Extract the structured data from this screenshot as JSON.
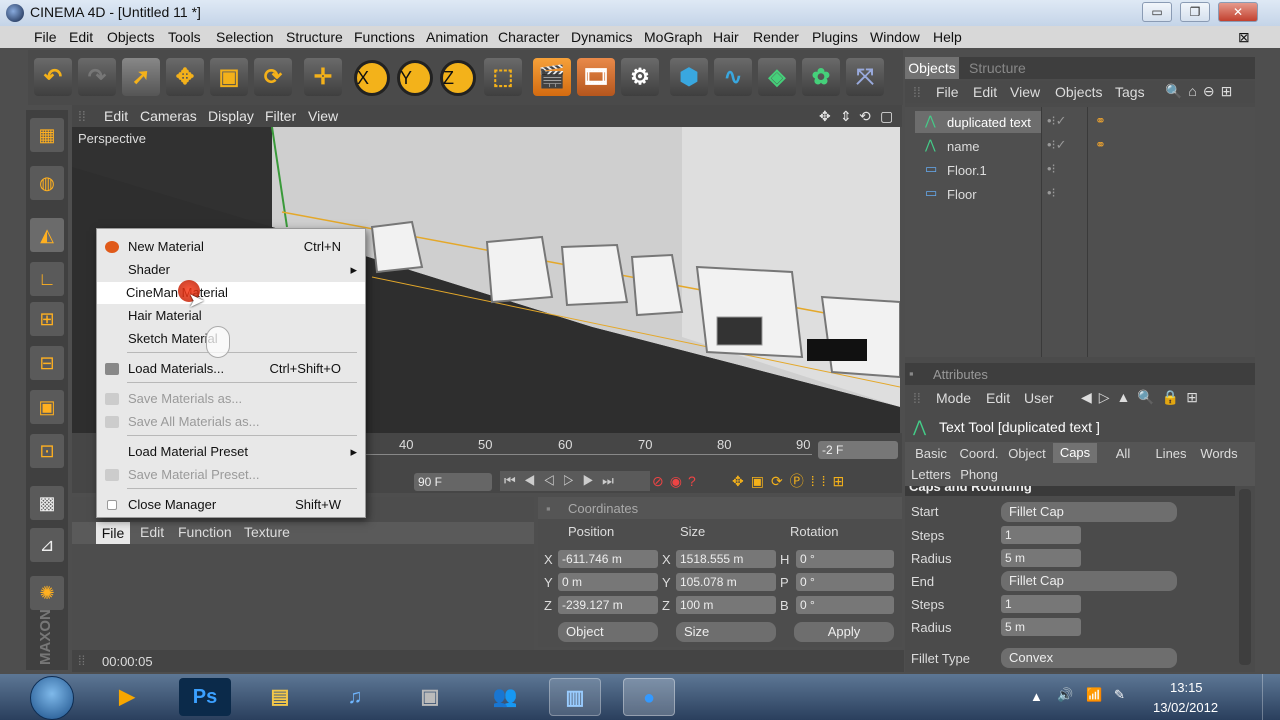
{
  "window": {
    "title": "CINEMA 4D - [Untitled 11 *]",
    "minimize": "▭",
    "restore": "❐",
    "close": "✕"
  },
  "menu": [
    "File",
    "Edit",
    "Objects",
    "Tools",
    "Selection",
    "Structure",
    "Functions",
    "Animation",
    "Character",
    "Dynamics",
    "MoGraph",
    "Hair",
    "Render",
    "Plugins",
    "Window",
    "Help"
  ],
  "toolbar": {
    "axis_x": "X",
    "axis_y": "Y",
    "axis_z": "Z"
  },
  "viewport": {
    "menu": [
      "Edit",
      "Cameras",
      "Display",
      "Filter",
      "View"
    ],
    "label": "Perspective",
    "scene_text": "EXEPIIOZ"
  },
  "timeline": {
    "ticks": [
      "40",
      "50",
      "60",
      "70",
      "80",
      "90"
    ],
    "frame_end": "-2 F",
    "max_frames": "90 F"
  },
  "materials": {
    "tabs": [
      "File",
      "Edit",
      "Function",
      "Texture"
    ],
    "time": "00:00:05"
  },
  "context_menu": {
    "items": [
      {
        "label": "New Material",
        "shortcut": "Ctrl+N",
        "enabled": true,
        "icon": "new-material-icon"
      },
      {
        "label": "Shader",
        "shortcut": "▸",
        "enabled": true
      },
      {
        "label": "CineMan Material",
        "shortcut": "",
        "enabled": true,
        "highlighted": true
      },
      {
        "label": "Hair Material",
        "shortcut": "",
        "enabled": true
      },
      {
        "label": "Sketch Material",
        "shortcut": "",
        "enabled": true
      },
      {
        "label": "Load Materials...",
        "shortcut": "Ctrl+Shift+O",
        "enabled": true,
        "icon": "load-icon"
      },
      {
        "label": "Save Materials as...",
        "shortcut": "",
        "enabled": false,
        "icon": "save-icon"
      },
      {
        "label": "Save All Materials as...",
        "shortcut": "",
        "enabled": false,
        "icon": "save-icon"
      },
      {
        "label": "Load Material Preset",
        "shortcut": "▸",
        "enabled": true
      },
      {
        "label": "Save Material Preset...",
        "shortcut": "",
        "enabled": false,
        "icon": "save-icon"
      },
      {
        "label": "Close Manager",
        "shortcut": "Shift+W",
        "enabled": true,
        "icon": "close-icon"
      }
    ]
  },
  "coordinates": {
    "title": "Coordinates",
    "headers": [
      "Position",
      "Size",
      "Rotation"
    ],
    "rows": [
      {
        "axis": "X",
        "pos": "-611.746 m",
        "saxis": "X",
        "size": "1518.555 m",
        "raxis": "H",
        "rot": "0 °"
      },
      {
        "axis": "Y",
        "pos": "0 m",
        "saxis": "Y",
        "size": "105.078 m",
        "raxis": "P",
        "rot": "0 °"
      },
      {
        "axis": "Z",
        "pos": "-239.127 m",
        "saxis": "Z",
        "size": "100 m",
        "raxis": "B",
        "rot": "0 °"
      }
    ],
    "object_mode": "Object",
    "size_mode": "Size",
    "apply": "Apply"
  },
  "objects": {
    "tabs": [
      "Objects",
      "Structure"
    ],
    "menu": [
      "File",
      "Edit",
      "View",
      "Objects",
      "Tags"
    ],
    "list": [
      {
        "name": "duplicated text",
        "selected": true
      },
      {
        "name": "name",
        "selected": false
      },
      {
        "name": "Floor.1",
        "selected": false
      },
      {
        "name": "Floor",
        "selected": false
      }
    ]
  },
  "attributes": {
    "title": "Attributes",
    "menu": [
      "Mode",
      "Edit",
      "User"
    ],
    "tool": "Text Tool [duplicated text ]",
    "tabs": [
      "Basic",
      "Coord.",
      "Object",
      "Caps",
      "All",
      "Lines",
      "Words",
      "Letters",
      "Phong"
    ],
    "active_tab": "Caps",
    "section": "Caps and Rounding",
    "params": [
      {
        "label": "Start",
        "value": "Fillet Cap",
        "type": "dropdown"
      },
      {
        "label": "Steps",
        "value": "1",
        "type": "number"
      },
      {
        "label": "Radius",
        "value": "5 m",
        "type": "number"
      },
      {
        "label": "End",
        "value": "Fillet Cap",
        "type": "dropdown"
      },
      {
        "label": "Steps",
        "value": "1",
        "type": "number"
      },
      {
        "label": "Radius",
        "value": "5 m",
        "type": "number"
      },
      {
        "label": "Fillet Type",
        "value": "Convex",
        "type": "dropdown"
      }
    ]
  },
  "taskbar": {
    "clock_time": "13:15",
    "clock_date": "13/02/2012"
  },
  "colors": {
    "accent": "#f3b21a",
    "selection": "#6d6d6d"
  }
}
